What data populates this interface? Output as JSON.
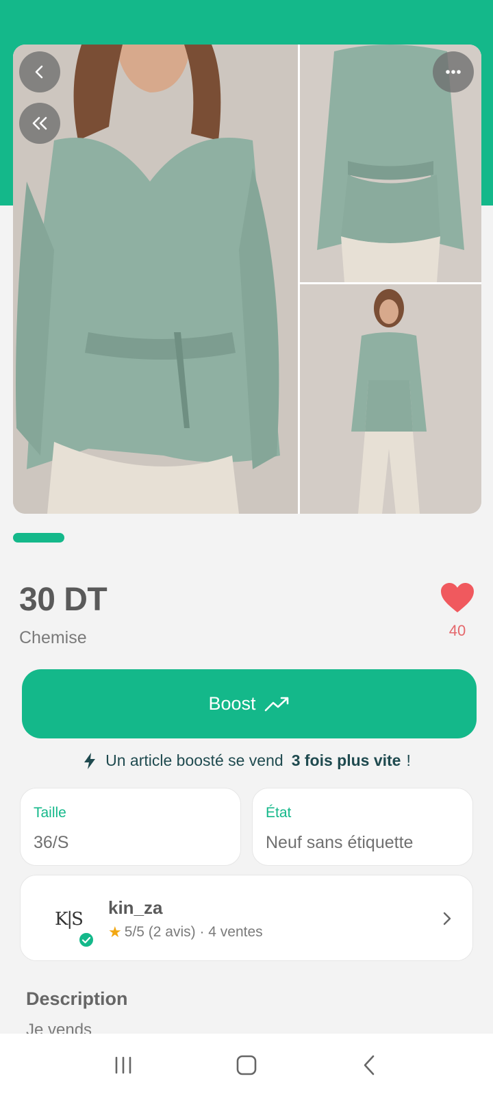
{
  "product": {
    "price": "30 DT",
    "category": "Chemise",
    "likes": "40",
    "images": [
      "main-front-photo",
      "back-view-photo",
      "full-body-photo"
    ],
    "gallery_progress": 0.25
  },
  "boost": {
    "button_label": "Boost",
    "info_prefix": "Un article boosté se vend",
    "info_bold": "3 fois plus vite",
    "info_suffix": "!"
  },
  "attributes": {
    "size_label": "Taille",
    "size_value": "36/S",
    "condition_label": "État",
    "condition_value": "Neuf sans étiquette"
  },
  "seller": {
    "logo_text": "K|S",
    "name": "kin_za",
    "rating": "5/5 (2 avis) · 4 ventes"
  },
  "description": {
    "title": "Description",
    "text": "Je vends"
  },
  "colors": {
    "brand": "#14b88a",
    "like": "#f0595e",
    "star": "#f2a712"
  },
  "icons": {
    "back": "chevron-left-icon",
    "first": "double-chevron-left-icon",
    "more": "more-horizontal-icon",
    "like": "heart-icon",
    "boost": "trending-up-icon",
    "bolt": "lightning-icon",
    "verified": "verified-check-icon",
    "seller": "chevron-right-icon"
  }
}
